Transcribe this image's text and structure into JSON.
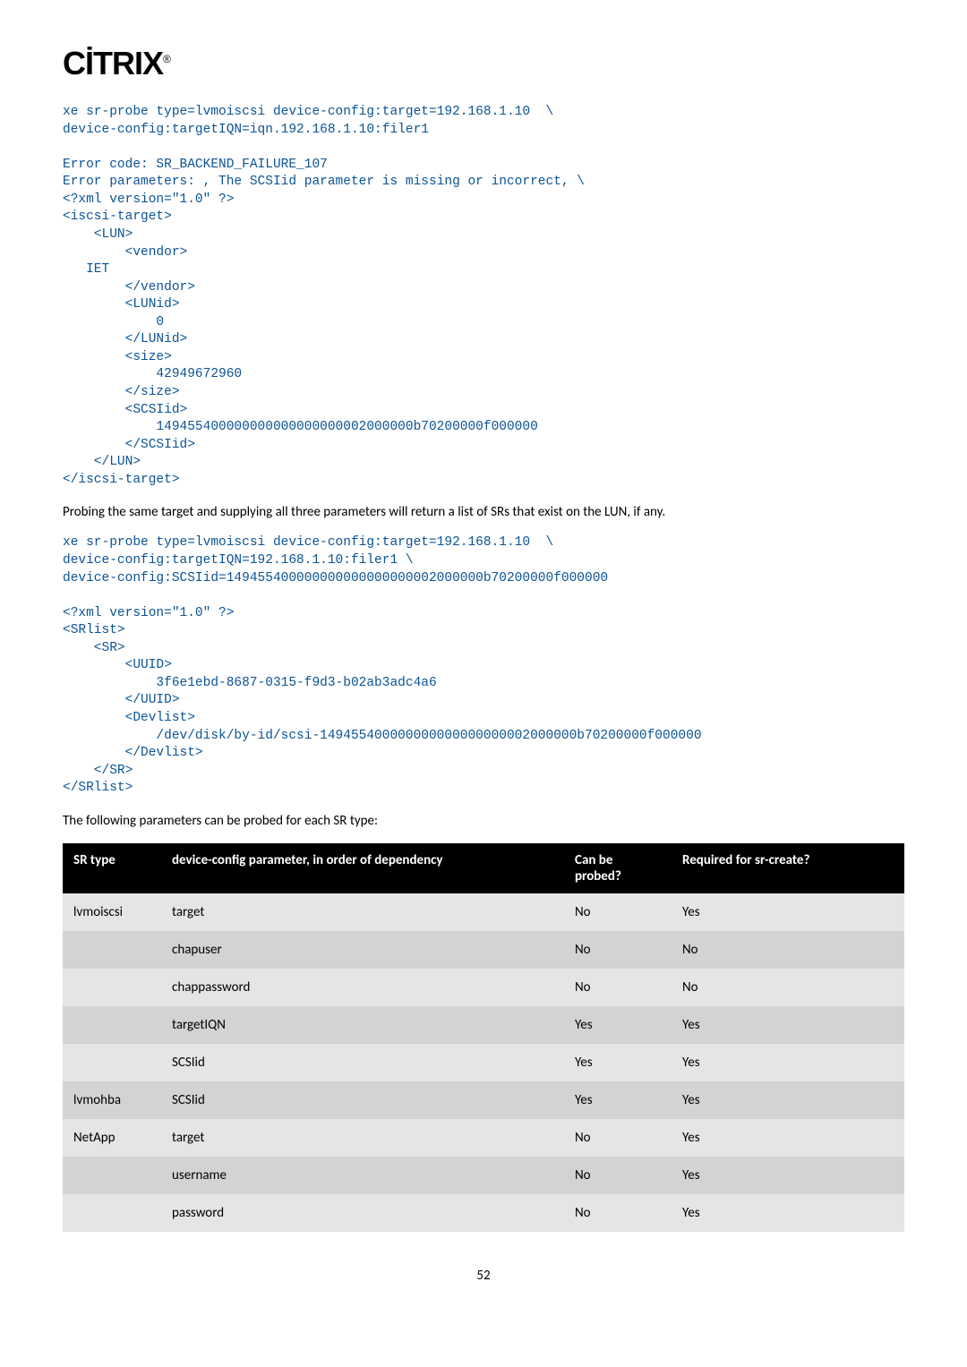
{
  "logo": "CİTRIX",
  "code1": "xe sr-probe type=lvmoiscsi device-config:target=192.168.1.10  \\\ndevice-config:targetIQN=iqn.192.168.1.10:filer1\n\nError code: SR_BACKEND_FAILURE_107\nError parameters: , The SCSIid parameter is missing or incorrect, \\\n<?xml version=\"1.0\" ?>\n<iscsi-target>\n    <LUN>\n        <vendor>\n   IET\n        </vendor>\n        <LUNid>\n            0\n        </LUNid>\n        <size>\n            42949672960\n        </size>\n        <SCSIid>\n            149455400000000000000000002000000b70200000f000000\n        </SCSIid>\n    </LUN>\n</iscsi-target>",
  "para1": "Probing the same target and supplying all three parameters will return a list of SRs that exist on the LUN, if any.",
  "code2": "xe sr-probe type=lvmoiscsi device-config:target=192.168.1.10  \\\ndevice-config:targetIQN=192.168.1.10:filer1 \\\ndevice-config:SCSIid=149455400000000000000000002000000b70200000f000000\n\n<?xml version=\"1.0\" ?>\n<SRlist>\n    <SR>\n        <UUID>\n            3f6e1ebd-8687-0315-f9d3-b02ab3adc4a6\n        </UUID>\n        <Devlist>\n            /dev/disk/by-id/scsi-149455400000000000000000002000000b70200000f000000\n        </Devlist>\n    </SR>\n</SRlist>",
  "para2": "The following parameters can be probed for each SR type:",
  "table": {
    "headers": {
      "srtype": "SR type",
      "param": "device-config parameter, in order of dependency",
      "probed": "Can be probed?",
      "required": "Required for sr-create?"
    },
    "rows": [
      {
        "srtype": "lvmoiscsi",
        "param": "target",
        "probed": "No",
        "required": "Yes"
      },
      {
        "srtype": "",
        "param": "chapuser",
        "probed": "No",
        "required": "No"
      },
      {
        "srtype": "",
        "param": "chappassword",
        "probed": "No",
        "required": "No"
      },
      {
        "srtype": "",
        "param": "targetIQN",
        "probed": "Yes",
        "required": "Yes"
      },
      {
        "srtype": "",
        "param": "SCSIid",
        "probed": "Yes",
        "required": "Yes"
      },
      {
        "srtype": "lvmohba",
        "param": "SCSIid",
        "probed": "Yes",
        "required": "Yes"
      },
      {
        "srtype": "NetApp",
        "param": "target",
        "probed": "No",
        "required": "Yes"
      },
      {
        "srtype": "",
        "param": "username",
        "probed": "No",
        "required": "Yes"
      },
      {
        "srtype": "",
        "param": "password",
        "probed": "No",
        "required": "Yes"
      }
    ]
  },
  "page_number": "52"
}
